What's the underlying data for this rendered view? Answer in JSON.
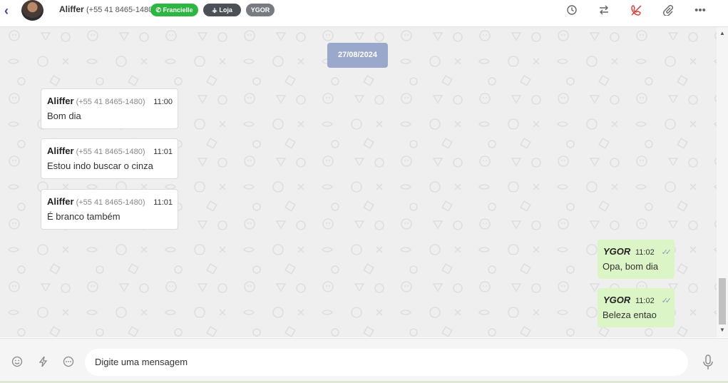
{
  "header": {
    "back_icon": "chevron-left-icon",
    "contact_name": "Aliffer",
    "contact_phone": "(+55 41 8465-1480)",
    "badges": [
      {
        "label": "Francielle",
        "icon": "whatsapp-icon",
        "color": "#2db742"
      },
      {
        "label": "Loja",
        "icon": "sitemap-icon",
        "color": "#4b4f56"
      },
      {
        "label": "YGOR",
        "color": "#777b82"
      }
    ],
    "actions": [
      "history-icon",
      "transfer-icon",
      "end-call-icon",
      "attach-icon",
      "more-icon"
    ]
  },
  "conversation": {
    "date": "27/08/2024",
    "incoming": [
      {
        "sender": "Aliffer",
        "phone": "(+55 41 8465-1480)",
        "time": "11:00",
        "text": "Bom dia"
      },
      {
        "sender": "Aliffer",
        "phone": "(+55 41 8465-1480)",
        "time": "11:01",
        "text": "Estou indo buscar o cinza"
      },
      {
        "sender": "Aliffer",
        "phone": "(+55 41 8465-1480)",
        "time": "11:01",
        "text": "É branco também"
      }
    ],
    "outgoing": [
      {
        "sender": "YGOR",
        "time": "11:02",
        "text": "Opa, bom dia",
        "status": "delivered"
      },
      {
        "sender": "YGOR",
        "time": "11:02",
        "text": "Beleza entao",
        "status": "delivered"
      }
    ]
  },
  "composer": {
    "placeholder": "Digite uma mensagem",
    "icons": [
      "emoji-icon",
      "lightning-icon",
      "chat-bubble-icon",
      "microphone-icon"
    ]
  },
  "colors": {
    "accent": "#3a4a8a",
    "whatsapp_green": "#2db742",
    "outgoing_bubble": "#dcf5c6",
    "date_badge": "#9aa8cc",
    "chat_background": "#efefef"
  }
}
